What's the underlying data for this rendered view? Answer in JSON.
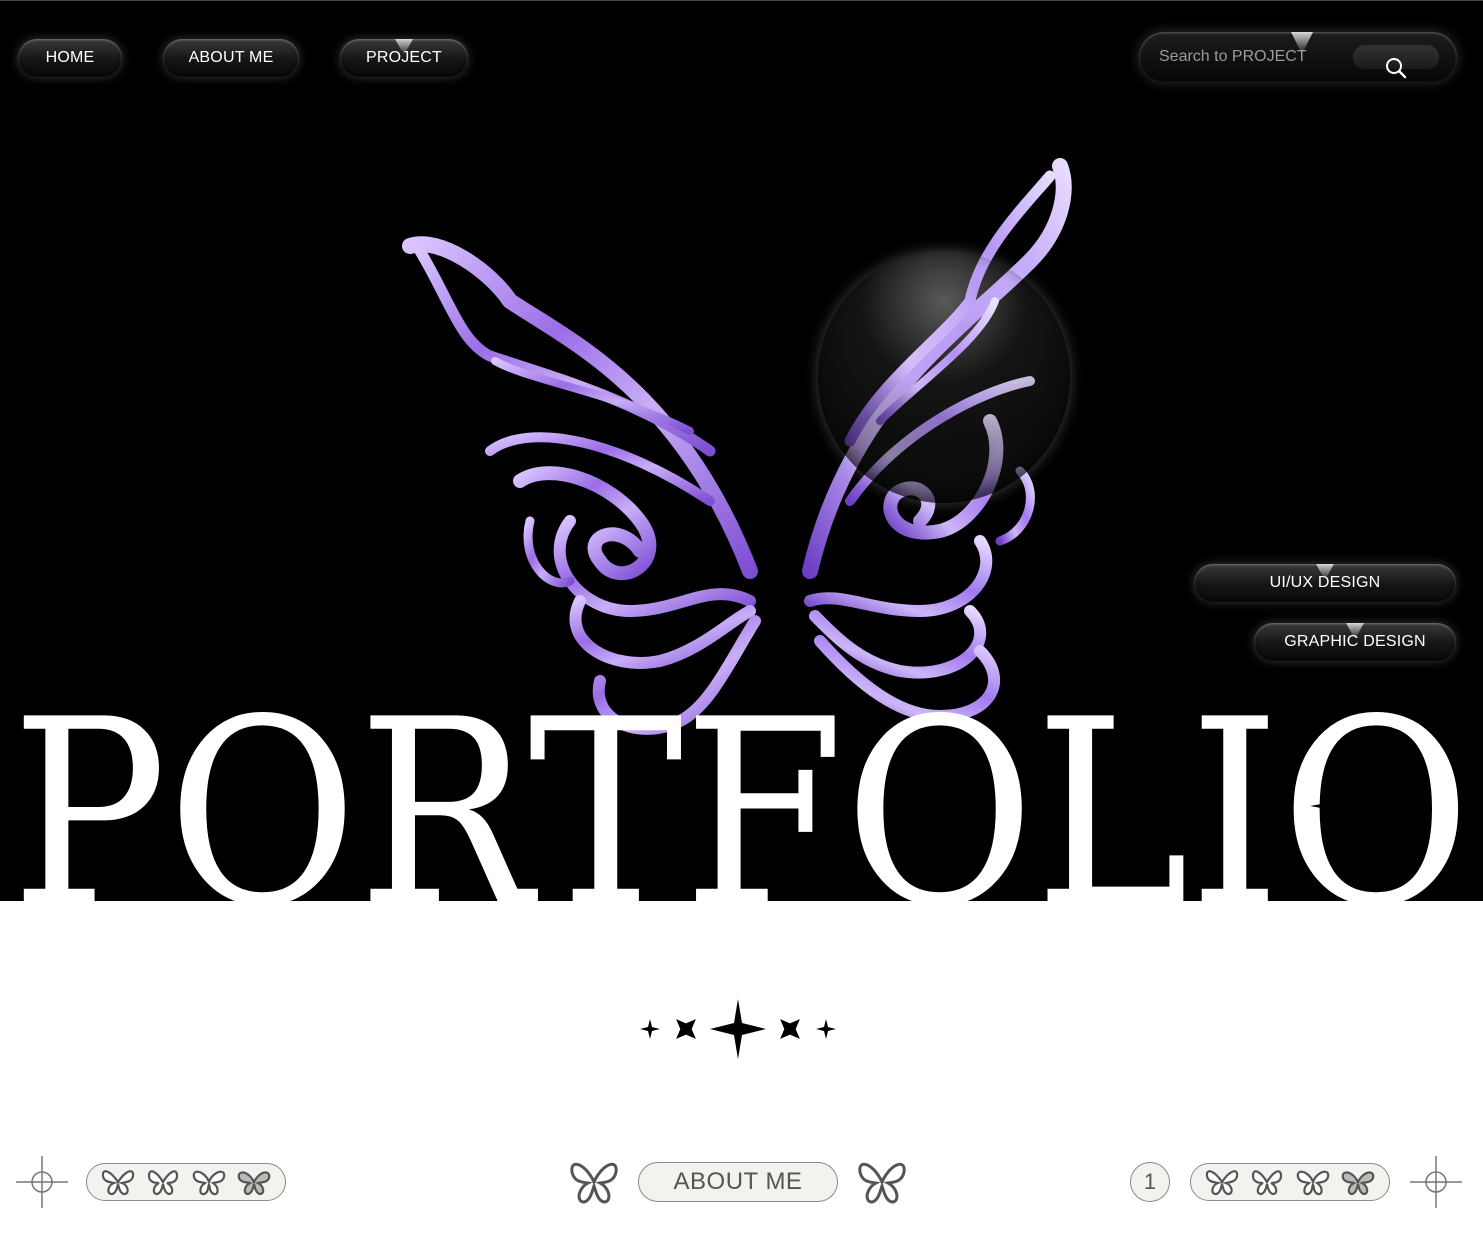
{
  "nav": {
    "home": "HOME",
    "about": "ABOUT ME",
    "project": "PROJECT"
  },
  "search": {
    "placeholder": "Search to PROJECT",
    "icon": "magnifier-icon"
  },
  "categories": {
    "uiux": "UI/UX DESIGN",
    "graphic": "GRAPHIC DESIGN"
  },
  "hero": {
    "wordmark": "PORTFOLIO",
    "illustration": "purple-crystal-butterfly",
    "accent_color": "#9b6ee6"
  },
  "footer": {
    "about_label": "ABOUT ME",
    "page_number": "1"
  },
  "colors": {
    "background_top": "#000000",
    "background_bottom": "#ffffff",
    "pill_fill": "#f4f2ef",
    "pill_border": "#8a8a8a"
  }
}
